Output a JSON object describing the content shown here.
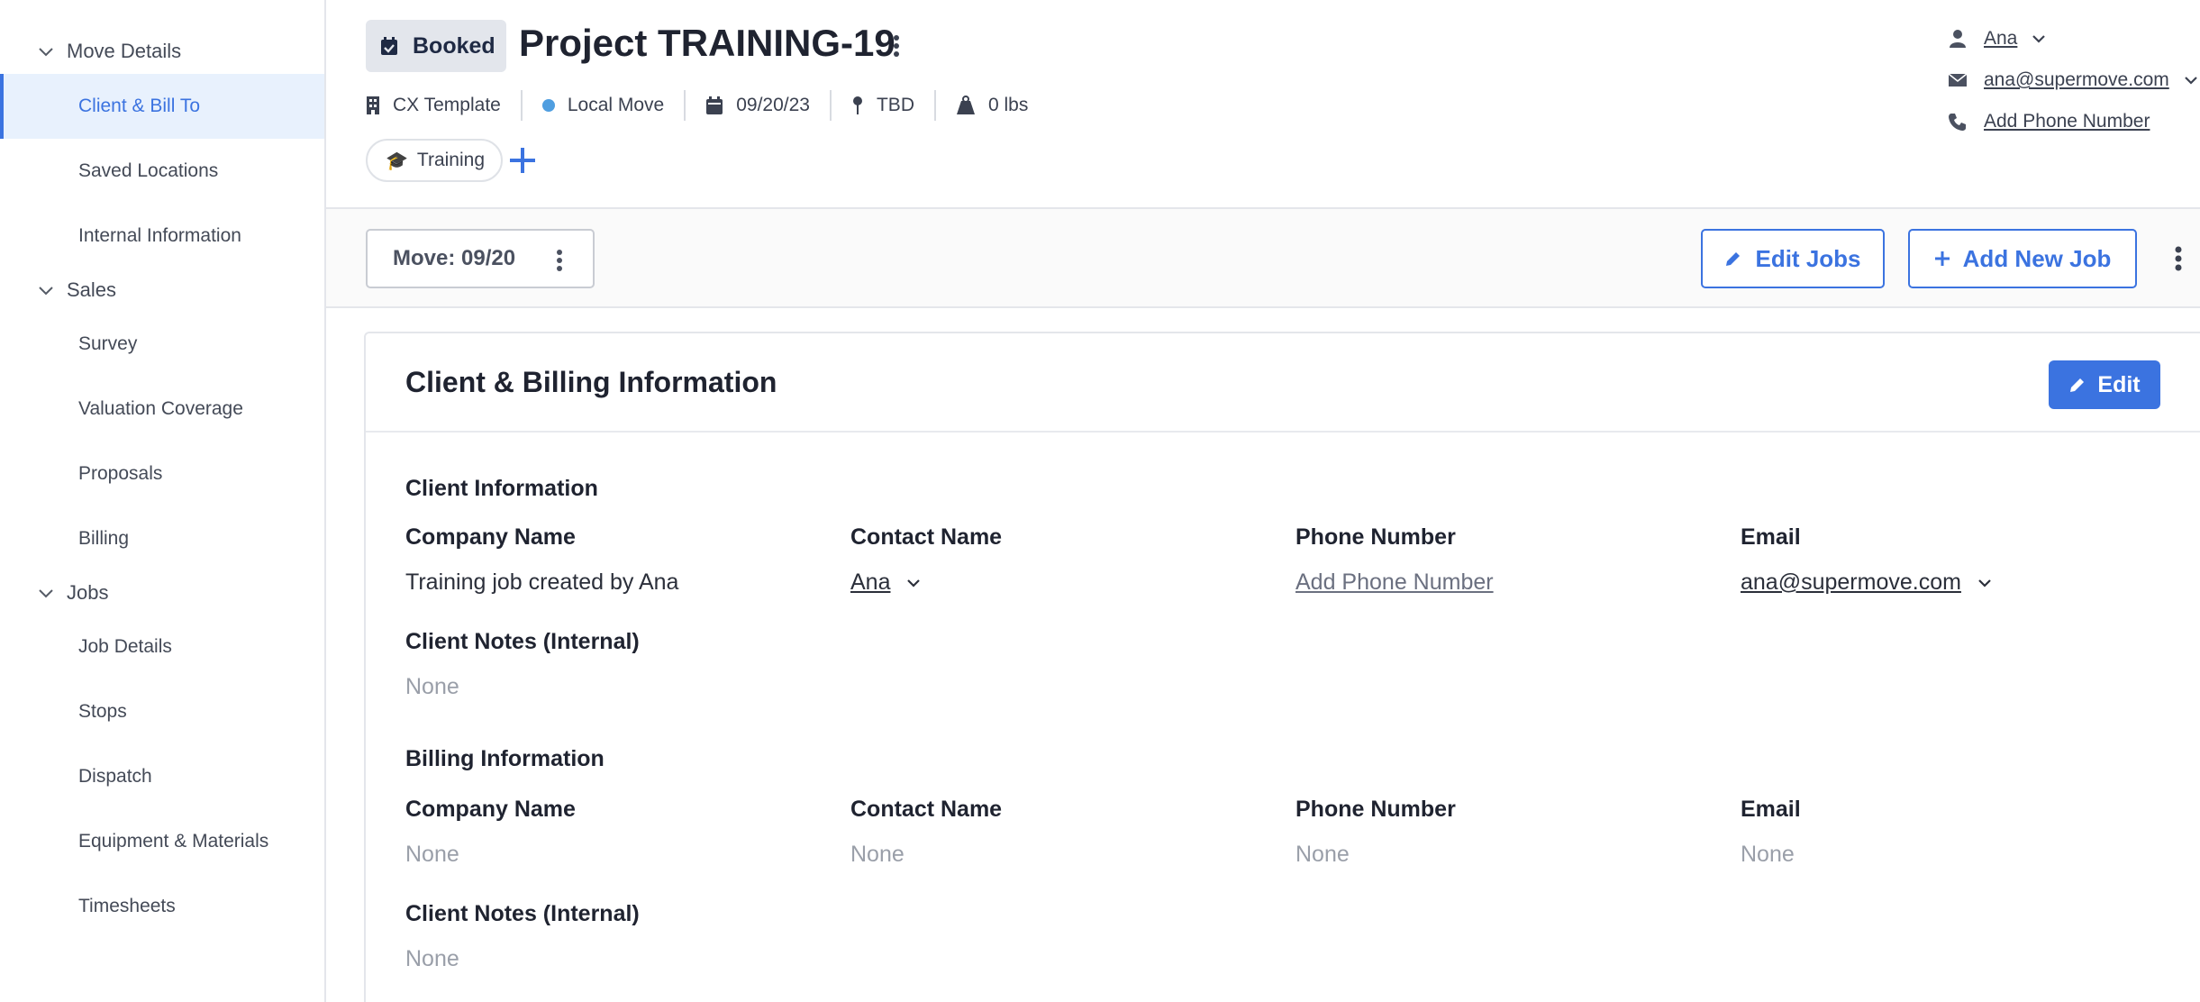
{
  "sidebar": {
    "groups": [
      {
        "label": "Move Details",
        "items": [
          "Client & Bill To",
          "Saved Locations",
          "Internal Information"
        ]
      },
      {
        "label": "Sales",
        "items": [
          "Survey",
          "Valuation Coverage",
          "Proposals",
          "Billing"
        ]
      },
      {
        "label": "Jobs",
        "items": [
          "Job Details",
          "Stops",
          "Dispatch",
          "Equipment & Materials",
          "Timesheets"
        ]
      }
    ],
    "active_item": "Client & Bill To"
  },
  "header": {
    "status": "Booked",
    "title": "Project TRAINING-19",
    "meta": {
      "template": "CX Template",
      "move_type": "Local Move",
      "date": "09/20/23",
      "location": "TBD",
      "weight": "0 lbs"
    },
    "tag": {
      "emoji": "🎓",
      "label": "Training"
    },
    "contact": {
      "name": "Ana",
      "email": "ana@supermove.com",
      "phone_link": "Add Phone Number"
    }
  },
  "jobbar": {
    "move_label": "Move: 09/20",
    "edit_jobs": "Edit Jobs",
    "add_new_job": "Add New Job"
  },
  "card": {
    "title": "Client & Billing Information",
    "edit_label": "Edit",
    "client": {
      "section": "Client Information",
      "labels": {
        "company": "Company Name",
        "contact": "Contact Name",
        "phone": "Phone Number",
        "email": "Email",
        "notes": "Client Notes (Internal)"
      },
      "company": "Training job created by Ana",
      "contact": "Ana",
      "phone": "Add Phone Number",
      "email": "ana@supermove.com",
      "notes": "None"
    },
    "billing": {
      "section": "Billing Information",
      "labels": {
        "company": "Company Name",
        "contact": "Contact Name",
        "phone": "Phone Number",
        "email": "Email",
        "notes": "Client Notes (Internal)"
      },
      "company": "None",
      "contact": "None",
      "phone": "None",
      "email": "None",
      "notes": "None"
    }
  },
  "colors": {
    "accent": "#3b73e0",
    "active_bg": "#e8f1fd",
    "move_dot": "#4f9ee0"
  }
}
